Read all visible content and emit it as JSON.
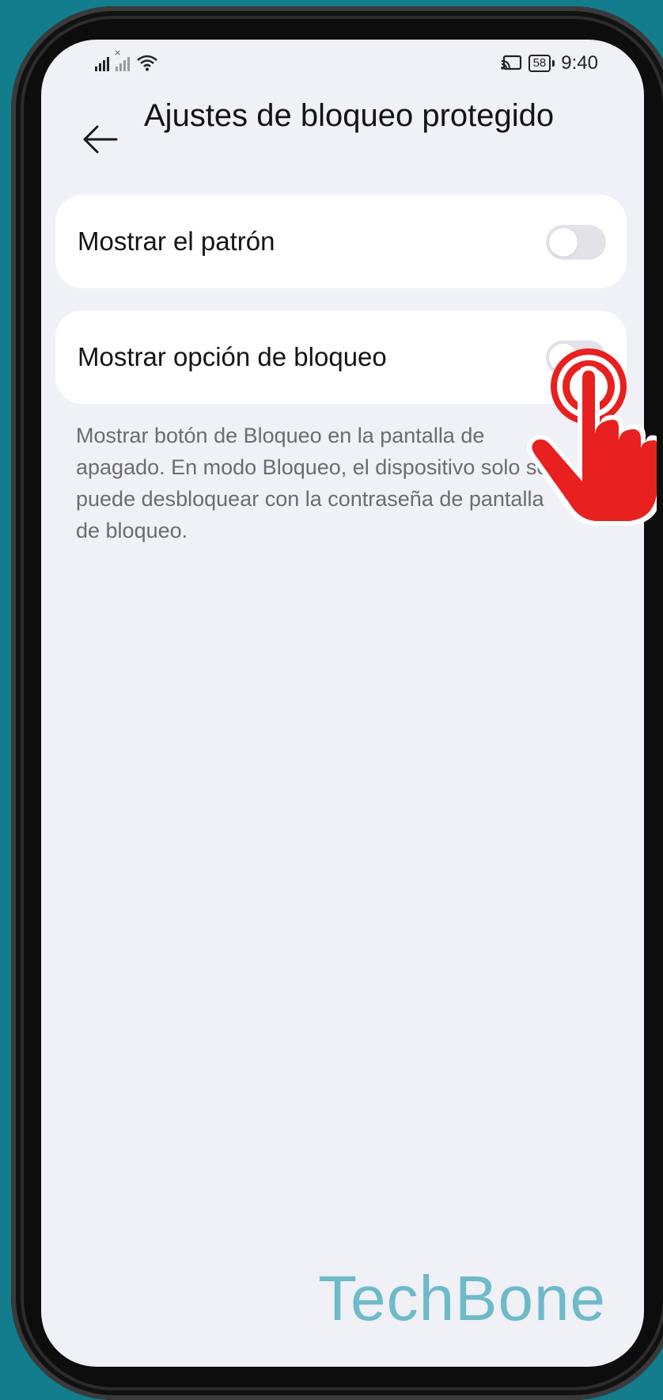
{
  "status_bar": {
    "time": "9:40",
    "battery": "58",
    "icons": [
      "signal-icon",
      "signal-no-sim-icon",
      "wifi-icon",
      "cast-icon",
      "battery-icon"
    ]
  },
  "header": {
    "back_icon": "arrow-left-icon",
    "title": "Ajustes de bloqueo protegido"
  },
  "settings": [
    {
      "label": "Mostrar el patrón",
      "enabled": false
    },
    {
      "label": "Mostrar opción de bloqueo",
      "enabled": false
    }
  ],
  "description": "Mostrar botón de Bloqueo en la pantalla de apagado. En modo Bloqueo, el dispositivo solo se puede desbloquear con la contraseña de pantalla de bloqueo.",
  "overlay": {
    "tap_icon": "tap-hand-icon",
    "watermark": "TechBone"
  },
  "colors": {
    "background": "#137d8d",
    "screen": "#f0f0f7",
    "card": "#ffffff",
    "tap": "#e8201f",
    "watermark": "#6dbac9"
  }
}
